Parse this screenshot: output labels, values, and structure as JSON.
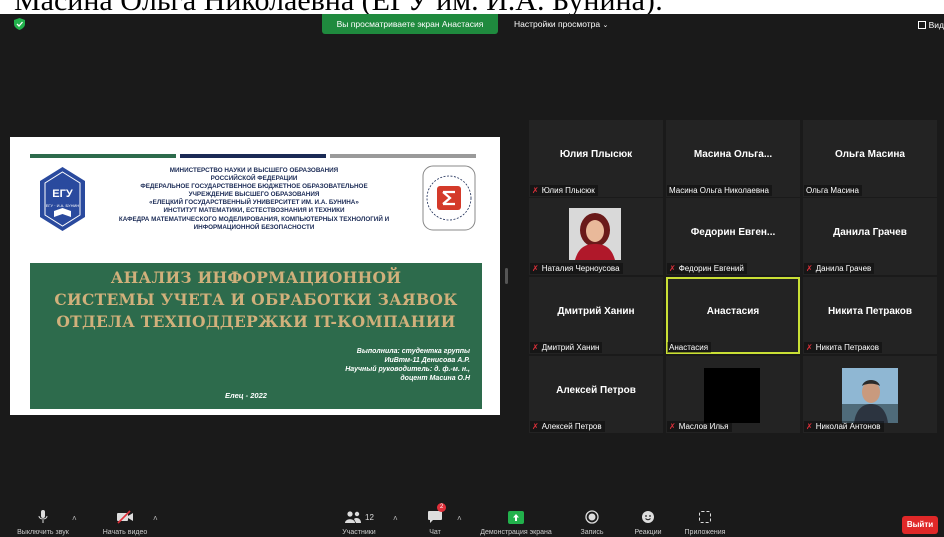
{
  "caption": "Масина Ольга Николаевна (ЕГУ им. И.А. Бунина):",
  "topbar": {
    "sharing_banner": "Вы просматриваете экран Анастасия",
    "view_options": "Настройки просмотра",
    "view_mode": "Вид"
  },
  "slide": {
    "header": [
      "МИНИСТЕРСТВО НАУКИ И ВЫСШЕГО ОБРАЗОВАНИЯ",
      "РОССИЙСКОЙ ФЕДЕРАЦИИ",
      "ФЕДЕРАЛЬНОЕ ГОСУДАРСТВЕННОЕ БЮДЖЕТНОЕ ОБРАЗОВАТЕЛЬНОЕ",
      "УЧРЕЖДЕНИЕ ВЫСШЕГО ОБРАЗОВАНИЯ",
      "«ЕЛЕЦКИЙ ГОСУДАРСТВЕННЫЙ УНИВЕРСИТЕТ ИМ. И.А. БУНИНА»",
      "ИНСТИТУТ МАТЕМАТИКИ, ЕСТЕСТВОЗНАНИЯ И ТЕХНИКИ",
      "КАФЕДРА МАТЕМАТИЧЕСКОГО МОДЕЛИРОВАНИЯ, КОМПЬЮТЕРНЫХ ТЕХНОЛОГИЙ И",
      "ИНФОРМАЦИОННОЙ БЕЗОПАСНОСТИ"
    ],
    "logo_text": "ЕГУ",
    "logo_caption": "ЕЛЕЦКИЙ ГОСУДАРСТВЕННЫЙ УНИВЕРСИТЕТ",
    "title": [
      "АНАЛИЗ ИНФОРМАЦИОННОЙ",
      "СИСТЕМЫ УЧЕТА И ОБРАБОТКИ ЗАЯВОК",
      "ОТДЕЛА ТЕХПОДДЕРЖКИ IT-КОМПАНИИ"
    ],
    "credits": [
      "Выполнила: студентка группы",
      "ИиВтм-11 Денисова А.Р.",
      "Научный руководитель: д. ф.-м. н.,",
      "доцент Масина О.Н"
    ],
    "city": "Елец - 2022"
  },
  "tiles": [
    {
      "center": "Юлия Плысюк",
      "label": "Юлия Плысюк",
      "muted": true
    },
    {
      "center": "Масина  Ольга...",
      "label": "Масина Ольга Николаевна",
      "muted": false
    },
    {
      "center": "Ольга Масина",
      "label": "Ольга Масина",
      "muted": false
    },
    {
      "center": "",
      "label": "Наталия Черноусова",
      "muted": true
    },
    {
      "center": "Федорин  Евген...",
      "label": "Федорин Евгений",
      "muted": true
    },
    {
      "center": "Данила Грачев",
      "label": "Данила Грачев",
      "muted": true
    },
    {
      "center": "Дмитрий Ханин",
      "label": "Дмитрий Ханин",
      "muted": true
    },
    {
      "center": "Анастасия",
      "label": "Анастасия",
      "muted": false
    },
    {
      "center": "Никита Петраков",
      "label": "Никита Петраков",
      "muted": true
    },
    {
      "center": "Алексей Петров",
      "label": "Алексей Петров",
      "muted": true
    },
    {
      "center": "",
      "label": "Маслов Илья",
      "muted": true
    },
    {
      "center": "",
      "label": "Николай Антонов",
      "muted": true
    }
  ],
  "toolbar": {
    "mute": "Выключить звук",
    "start_video": "Начать видео",
    "participants": "Участники",
    "participants_count": "12",
    "chat": "Чат",
    "chat_badge": "2",
    "share_screen": "Демонстрация экрана",
    "record": "Запись",
    "reactions": "Реакции",
    "apps": "Приложения",
    "leave": "Выйти"
  },
  "colors": {
    "share_green": "#1f8a3e",
    "active_border": "#c9df35",
    "leave_red": "#e02828",
    "slide_green": "#2d6b4c",
    "title_gold": "#d1b07b"
  }
}
